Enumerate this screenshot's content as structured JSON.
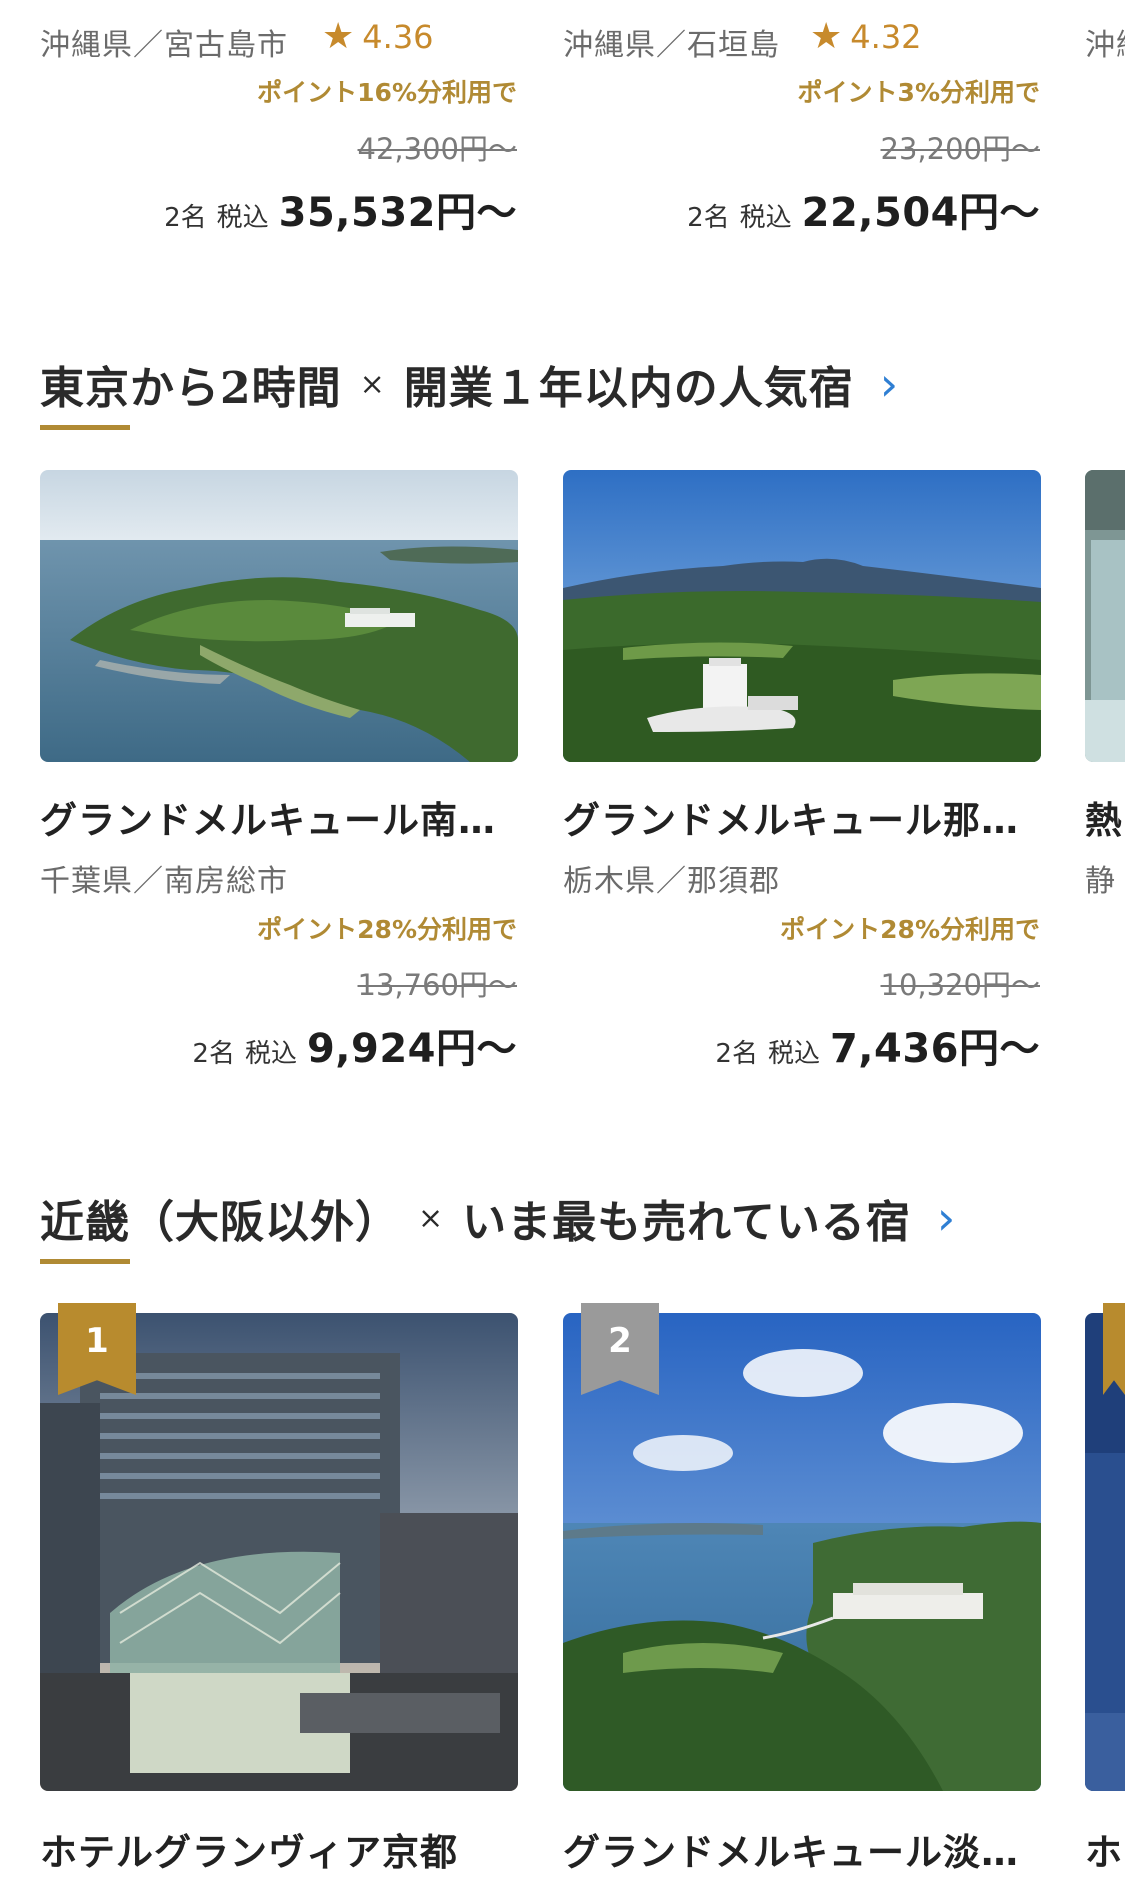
{
  "top_cards": [
    {
      "location": "沖縄県／宮古島市",
      "rating": "4.36",
      "point_text": "ポイント16%分利用で",
      "original_price": "42,300円〜",
      "guests": "2名",
      "tax_label": "税込",
      "price": "35,532円〜"
    },
    {
      "location": "沖縄県／石垣島",
      "rating": "4.32",
      "point_text": "ポイント3%分利用で",
      "original_price": "23,200円〜",
      "guests": "2名",
      "tax_label": "税込",
      "price": "22,504円〜"
    }
  ],
  "top_partial_location": "沖縄",
  "section1": {
    "title_part1": "東京から2時間",
    "separator": "×",
    "title_part2": "開業１年以内の人気宿",
    "cards": [
      {
        "name": "グランドメルキュール南…",
        "location": "千葉県／南房総市",
        "point_text": "ポイント28%分利用で",
        "original_price": "13,760円〜",
        "guests": "2名",
        "tax_label": "税込",
        "price": "9,924円〜"
      },
      {
        "name": "グランドメルキュール那…",
        "location": "栃木県／那須郡",
        "point_text": "ポイント28%分利用で",
        "original_price": "10,320円〜",
        "guests": "2名",
        "tax_label": "税込",
        "price": "7,436円〜"
      }
    ],
    "partial_name": "熱",
    "partial_location": "静"
  },
  "section2": {
    "title_part1": "近畿（大阪以外）",
    "separator": "×",
    "title_part2": "いま最も売れている宿",
    "cards": [
      {
        "rank": "1",
        "name": "ホテルグランヴィア京都"
      },
      {
        "rank": "2",
        "name": "グランドメルキュール淡…"
      }
    ],
    "partial_name": "ホ"
  },
  "colors": {
    "accent_gold": "#b08a34",
    "rating": "#c78a2c",
    "chevron_blue": "#2f7fd3"
  }
}
